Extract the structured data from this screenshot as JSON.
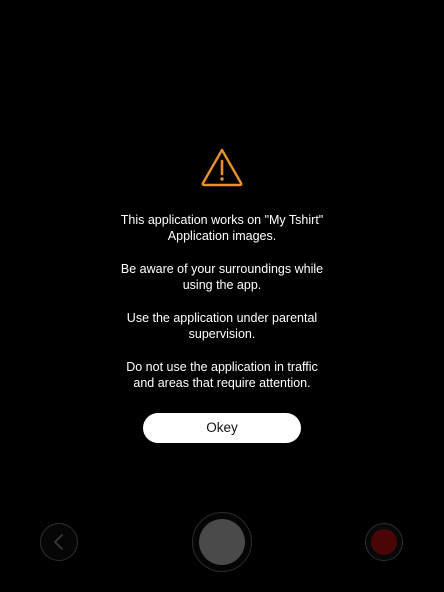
{
  "colors": {
    "background": "#000000",
    "warning_accent": "#e8902a",
    "button_bg": "#ffffff",
    "record_red": "#4a0606",
    "capture_gray": "#4a4a4a"
  },
  "icons": {
    "warning": "warning-triangle-icon",
    "back": "chevron-left-icon"
  },
  "dialog": {
    "messages": [
      [
        "This application works on \"My Tshirt\"",
        "Application images."
      ],
      [
        "Be aware of your surroundings while",
        "using the app."
      ],
      [
        "Use the application under parental",
        "supervision."
      ],
      [
        "Do not use the application in traffic",
        "and areas that require attention."
      ]
    ],
    "ok_label": "Okey"
  }
}
